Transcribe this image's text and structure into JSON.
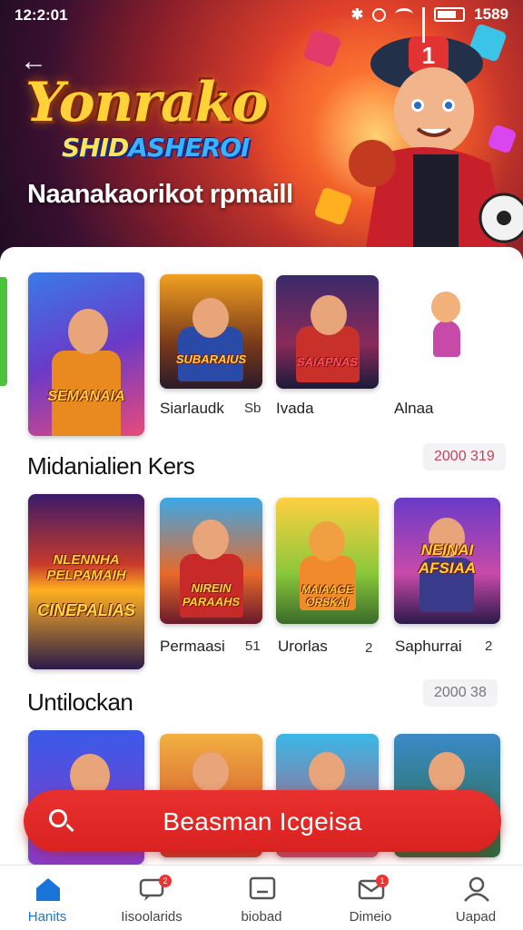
{
  "status_bar": {
    "time": "12:2:01",
    "battery": "1589"
  },
  "hero": {
    "title": "Yonrako",
    "subtitle_part1": "SHID",
    "subtitle_part2": "ASHEROI",
    "tagline": "Naanakaorikot rpmaill"
  },
  "row1": {
    "items": [
      {
        "label": "",
        "logo": "SEMANAIA",
        "num": ""
      },
      {
        "label": "Siarlaudk",
        "logo": "SUBARAIUS",
        "num": "Sb"
      },
      {
        "label": "Ivada",
        "logo": "SAIAPNAS",
        "num": ""
      },
      {
        "label": "Alnaa",
        "logo": "",
        "num": ""
      }
    ]
  },
  "section2": {
    "title": "Midanialien Kers",
    "pill": "2000 319",
    "items": [
      {
        "label": "",
        "logo_top": "NLENNHA PELPAMAIH",
        "logo_bottom": "CINEPALIAS",
        "num": ""
      },
      {
        "label": "Permaasi",
        "logo": "NIREIN PARAAHS",
        "num": "51"
      },
      {
        "label": "Urorlas",
        "logo": "MAIAAGE ORSKAI",
        "num": "2"
      },
      {
        "label": "Saphurrai",
        "logo": "NEINAI AFSIAA",
        "num": "2"
      }
    ]
  },
  "section3": {
    "title": "Untilockan",
    "pill": "2000 38"
  },
  "search_button": {
    "label": "Beasman Icgeisa"
  },
  "bottom_nav": {
    "items": [
      {
        "label": "Hanits",
        "icon": "home-icon",
        "active": true
      },
      {
        "label": "Iisoolarids",
        "icon": "chat-icon",
        "badge": "2"
      },
      {
        "label": "biobad",
        "icon": "tv-icon"
      },
      {
        "label": "Dimeio",
        "icon": "mail-icon",
        "badge": "1"
      },
      {
        "label": "Uapad",
        "icon": "profile-icon"
      }
    ]
  },
  "colors": {
    "accent": "#e8312f",
    "active_tab": "#1a73d9",
    "side_accent": "#4cc23a"
  }
}
